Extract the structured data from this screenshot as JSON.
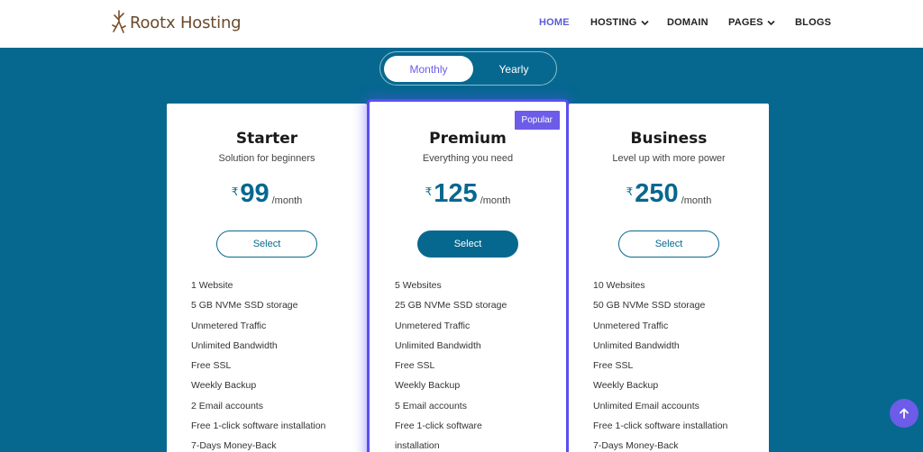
{
  "brand": {
    "name": "Rootx Hosting"
  },
  "nav": {
    "items": [
      {
        "label": "HOME",
        "active": true
      },
      {
        "label": "HOSTING",
        "dropdown": true
      },
      {
        "label": "DOMAIN"
      },
      {
        "label": "PAGES",
        "dropdown": true
      },
      {
        "label": "BLOGS"
      }
    ]
  },
  "billing_toggle": {
    "monthly": "Monthly",
    "yearly": "Yearly",
    "selected": "Monthly"
  },
  "plans": [
    {
      "name": "Starter",
      "subtitle": "Solution for beginners",
      "currency": "₹",
      "price": "99",
      "period": "/month",
      "button": "Select",
      "features": [
        "1 Website",
        "5 GB NVMe SSD storage",
        "Unmetered Traffic",
        "Unlimited Bandwidth",
        "Free SSL",
        "Weekly Backup",
        "2 Email accounts",
        "Free 1-click software installation",
        "7-Days Money-Back"
      ]
    },
    {
      "name": "Premium",
      "badge": "Popular",
      "subtitle": "Everything you need",
      "currency": "₹",
      "price": "125",
      "period": "/month",
      "button": "Select",
      "features": [
        "5 Websites",
        "25 GB NVMe SSD storage",
        "Unmetered Traffic",
        "Unlimited Bandwidth",
        "Free SSL",
        "Weekly Backup",
        "5 Email accounts",
        "Free 1-click software",
        "installation"
      ]
    },
    {
      "name": "Business",
      "subtitle": "Level up with more power",
      "currency": "₹",
      "price": "250",
      "period": "/month",
      "button": "Select",
      "features": [
        "10 Websites",
        "50 GB NVMe SSD storage",
        "Unmetered Traffic",
        "Unlimited Bandwidth",
        "Free SSL",
        "Weekly Backup",
        "Unlimited Email accounts",
        "Free 1-click software installation",
        "7-Days Money-Back"
      ]
    }
  ],
  "icons": {
    "logo": "root-logo-icon",
    "dropdown": "chevron-down-icon",
    "scroll_top": "arrow-up-icon"
  },
  "colors": {
    "primary": "#06688f",
    "accent": "#6c5ce7",
    "brand_text": "#6b4a2b"
  }
}
